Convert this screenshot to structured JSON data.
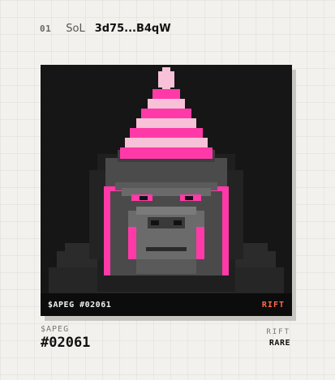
{
  "header": {
    "index": "01",
    "chain": "SoL",
    "address": "3d75...B4qW"
  },
  "card": {
    "image_subject": "pixel-art gorilla wearing a pink striped party hat",
    "caption_token": "$APEG #02061",
    "caption_badge": "RIFT"
  },
  "footer": {
    "symbol": "$APEG",
    "number": "#02061",
    "trait_label": "RIFT",
    "rarity": "RARE"
  },
  "colors": {
    "badge": "#ff6a45",
    "hat_pink": "#ff3aa8",
    "hat_stripe": "#f7c1d8",
    "fur": "#4a4a4a",
    "background": "#161616"
  }
}
